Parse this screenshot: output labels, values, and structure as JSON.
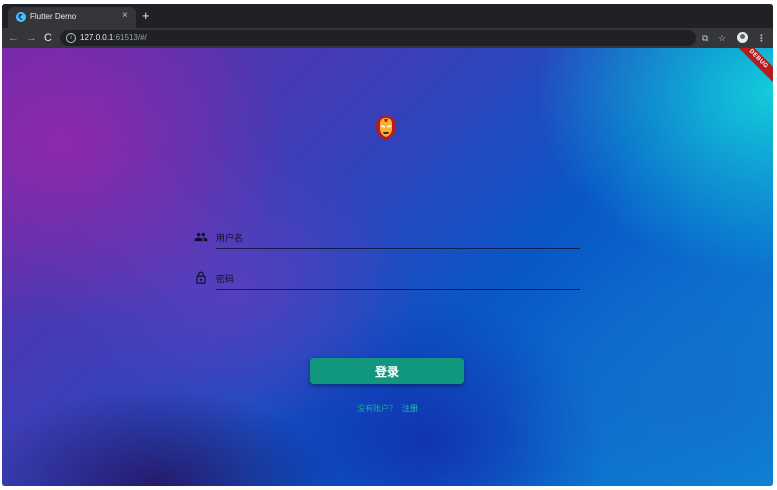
{
  "browser": {
    "tab_title": "Flutter Demo",
    "tab_close": "×",
    "new_tab": "+",
    "url_host": "127.0.0.1",
    "url_rest": ":61513/#/",
    "back": "←",
    "forward": "→",
    "reload": "C",
    "info": "i",
    "translate": "⧉",
    "star": "☆",
    "menu": "⋮"
  },
  "app": {
    "debug_banner": "DEBUG",
    "username_placeholder": "用户名",
    "password_placeholder": "密码",
    "login_label": "登录",
    "no_account_text": "没有账户？",
    "register_label": "注册"
  },
  "colors": {
    "button": "#10977d",
    "link": "#19c89a"
  },
  "icons": {
    "username": "people-icon",
    "password": "lock-icon",
    "logo": "iron-man-mask-icon"
  }
}
